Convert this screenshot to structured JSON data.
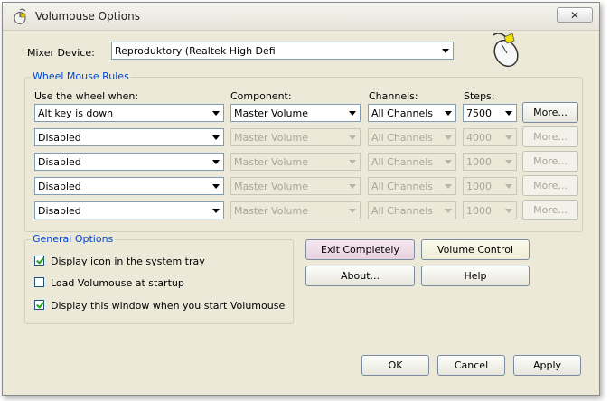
{
  "window": {
    "title": "Volumouse Options",
    "close_glyph": "✕"
  },
  "mixer": {
    "label": "Mixer Device:",
    "value": "Reproduktory (Realtek High Defi"
  },
  "rules": {
    "group_title": "Wheel Mouse Rules",
    "headers": {
      "when": "Use the wheel when:",
      "component": "Component:",
      "channels": "Channels:",
      "steps": "Steps:"
    },
    "more_label": "More...",
    "rows": [
      {
        "when": "Alt key is down",
        "component": "Master Volume",
        "channels": "All Channels",
        "steps": "7500"
      },
      {
        "when": "Disabled",
        "component": "Master Volume",
        "channels": "All Channels",
        "steps": "4000"
      },
      {
        "when": "Disabled",
        "component": "Master Volume",
        "channels": "All Channels",
        "steps": "1000"
      },
      {
        "when": "Disabled",
        "component": "Master Volume",
        "channels": "All Channels",
        "steps": "1000"
      },
      {
        "when": "Disabled",
        "component": "Master Volume",
        "channels": "All Channels",
        "steps": "1000"
      }
    ]
  },
  "general": {
    "group_title": "General Options",
    "options": [
      {
        "label": "Display icon in the system tray",
        "checked": true
      },
      {
        "label": "Load Volumouse at startup",
        "checked": false
      },
      {
        "label": "Display this window when you start Volumouse",
        "checked": true
      }
    ]
  },
  "buttons": {
    "exit": "Exit Completely",
    "volume": "Volume Control",
    "about": "About...",
    "help": "Help",
    "ok": "OK",
    "cancel": "Cancel",
    "apply": "Apply"
  }
}
